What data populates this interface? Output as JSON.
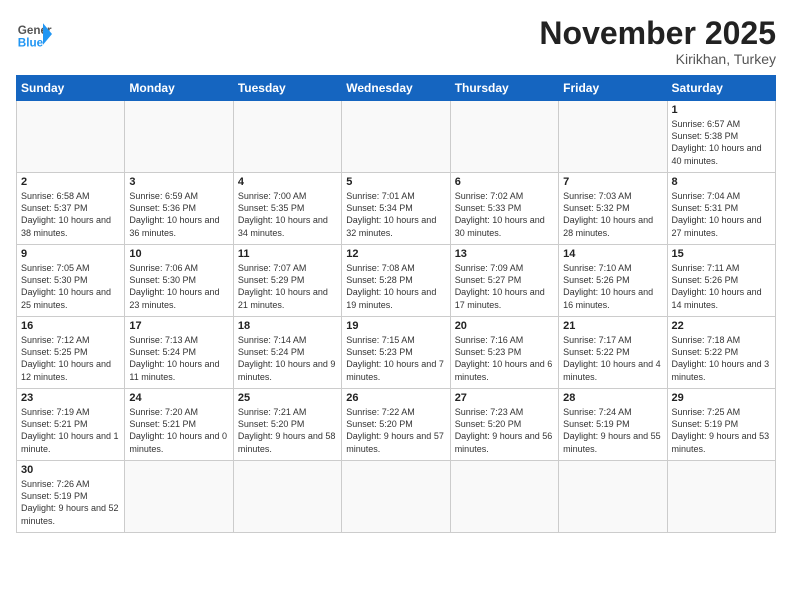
{
  "header": {
    "logo_general": "General",
    "logo_blue": "Blue",
    "month": "November 2025",
    "location": "Kirikhan, Turkey"
  },
  "days_of_week": [
    "Sunday",
    "Monday",
    "Tuesday",
    "Wednesday",
    "Thursday",
    "Friday",
    "Saturday"
  ],
  "weeks": [
    [
      {
        "day": "",
        "info": ""
      },
      {
        "day": "",
        "info": ""
      },
      {
        "day": "",
        "info": ""
      },
      {
        "day": "",
        "info": ""
      },
      {
        "day": "",
        "info": ""
      },
      {
        "day": "",
        "info": ""
      },
      {
        "day": "1",
        "info": "Sunrise: 6:57 AM\nSunset: 5:38 PM\nDaylight: 10 hours and 40 minutes."
      }
    ],
    [
      {
        "day": "2",
        "info": "Sunrise: 6:58 AM\nSunset: 5:37 PM\nDaylight: 10 hours and 38 minutes."
      },
      {
        "day": "3",
        "info": "Sunrise: 6:59 AM\nSunset: 5:36 PM\nDaylight: 10 hours and 36 minutes."
      },
      {
        "day": "4",
        "info": "Sunrise: 7:00 AM\nSunset: 5:35 PM\nDaylight: 10 hours and 34 minutes."
      },
      {
        "day": "5",
        "info": "Sunrise: 7:01 AM\nSunset: 5:34 PM\nDaylight: 10 hours and 32 minutes."
      },
      {
        "day": "6",
        "info": "Sunrise: 7:02 AM\nSunset: 5:33 PM\nDaylight: 10 hours and 30 minutes."
      },
      {
        "day": "7",
        "info": "Sunrise: 7:03 AM\nSunset: 5:32 PM\nDaylight: 10 hours and 28 minutes."
      },
      {
        "day": "8",
        "info": "Sunrise: 7:04 AM\nSunset: 5:31 PM\nDaylight: 10 hours and 27 minutes."
      }
    ],
    [
      {
        "day": "9",
        "info": "Sunrise: 7:05 AM\nSunset: 5:30 PM\nDaylight: 10 hours and 25 minutes."
      },
      {
        "day": "10",
        "info": "Sunrise: 7:06 AM\nSunset: 5:30 PM\nDaylight: 10 hours and 23 minutes."
      },
      {
        "day": "11",
        "info": "Sunrise: 7:07 AM\nSunset: 5:29 PM\nDaylight: 10 hours and 21 minutes."
      },
      {
        "day": "12",
        "info": "Sunrise: 7:08 AM\nSunset: 5:28 PM\nDaylight: 10 hours and 19 minutes."
      },
      {
        "day": "13",
        "info": "Sunrise: 7:09 AM\nSunset: 5:27 PM\nDaylight: 10 hours and 17 minutes."
      },
      {
        "day": "14",
        "info": "Sunrise: 7:10 AM\nSunset: 5:26 PM\nDaylight: 10 hours and 16 minutes."
      },
      {
        "day": "15",
        "info": "Sunrise: 7:11 AM\nSunset: 5:26 PM\nDaylight: 10 hours and 14 minutes."
      }
    ],
    [
      {
        "day": "16",
        "info": "Sunrise: 7:12 AM\nSunset: 5:25 PM\nDaylight: 10 hours and 12 minutes."
      },
      {
        "day": "17",
        "info": "Sunrise: 7:13 AM\nSunset: 5:24 PM\nDaylight: 10 hours and 11 minutes."
      },
      {
        "day": "18",
        "info": "Sunrise: 7:14 AM\nSunset: 5:24 PM\nDaylight: 10 hours and 9 minutes."
      },
      {
        "day": "19",
        "info": "Sunrise: 7:15 AM\nSunset: 5:23 PM\nDaylight: 10 hours and 7 minutes."
      },
      {
        "day": "20",
        "info": "Sunrise: 7:16 AM\nSunset: 5:23 PM\nDaylight: 10 hours and 6 minutes."
      },
      {
        "day": "21",
        "info": "Sunrise: 7:17 AM\nSunset: 5:22 PM\nDaylight: 10 hours and 4 minutes."
      },
      {
        "day": "22",
        "info": "Sunrise: 7:18 AM\nSunset: 5:22 PM\nDaylight: 10 hours and 3 minutes."
      }
    ],
    [
      {
        "day": "23",
        "info": "Sunrise: 7:19 AM\nSunset: 5:21 PM\nDaylight: 10 hours and 1 minute."
      },
      {
        "day": "24",
        "info": "Sunrise: 7:20 AM\nSunset: 5:21 PM\nDaylight: 10 hours and 0 minutes."
      },
      {
        "day": "25",
        "info": "Sunrise: 7:21 AM\nSunset: 5:20 PM\nDaylight: 9 hours and 58 minutes."
      },
      {
        "day": "26",
        "info": "Sunrise: 7:22 AM\nSunset: 5:20 PM\nDaylight: 9 hours and 57 minutes."
      },
      {
        "day": "27",
        "info": "Sunrise: 7:23 AM\nSunset: 5:20 PM\nDaylight: 9 hours and 56 minutes."
      },
      {
        "day": "28",
        "info": "Sunrise: 7:24 AM\nSunset: 5:19 PM\nDaylight: 9 hours and 55 minutes."
      },
      {
        "day": "29",
        "info": "Sunrise: 7:25 AM\nSunset: 5:19 PM\nDaylight: 9 hours and 53 minutes."
      }
    ],
    [
      {
        "day": "30",
        "info": "Sunrise: 7:26 AM\nSunset: 5:19 PM\nDaylight: 9 hours and 52 minutes."
      },
      {
        "day": "",
        "info": ""
      },
      {
        "day": "",
        "info": ""
      },
      {
        "day": "",
        "info": ""
      },
      {
        "day": "",
        "info": ""
      },
      {
        "day": "",
        "info": ""
      },
      {
        "day": "",
        "info": ""
      }
    ]
  ]
}
